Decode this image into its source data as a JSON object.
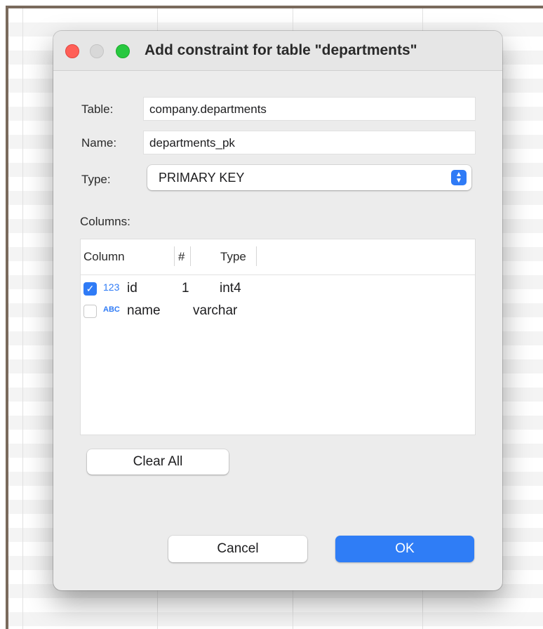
{
  "dialog": {
    "title": "Add constraint for table \"departments\"",
    "colors": {
      "accent": "#2f7bf6",
      "close": "#ff5f57",
      "maximize": "#28c840"
    }
  },
  "form": {
    "table_label": "Table:",
    "table_value": "company.departments",
    "name_label": "Name:",
    "name_value": "departments_pk",
    "type_label": "Type:",
    "type_value": "PRIMARY KEY",
    "columns_label": "Columns:"
  },
  "columns_table": {
    "headers": [
      "Column",
      "#",
      "Type"
    ],
    "rows": [
      {
        "checked": true,
        "type_icon": "123",
        "column": "id",
        "num": "1",
        "type": "int4"
      },
      {
        "checked": false,
        "type_icon": "ABC",
        "column": "name",
        "num": "",
        "type": "varchar"
      }
    ]
  },
  "buttons": {
    "clear_all": "Clear All",
    "cancel": "Cancel",
    "ok": "OK"
  }
}
